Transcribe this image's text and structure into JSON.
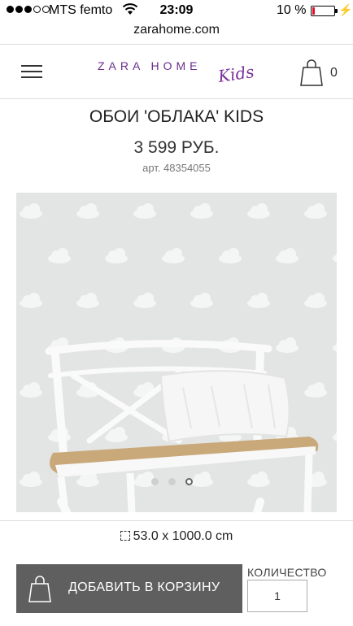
{
  "status_bar": {
    "carrier": "MTS femto",
    "time": "23:09",
    "battery_percent": "10 %",
    "battery_level": 0.1
  },
  "browser": {
    "url": "zarahome.com"
  },
  "header": {
    "brand": "ZARA HOME",
    "sub_brand": "Kids",
    "cart_count": "0"
  },
  "product": {
    "title": "ОБОИ 'ОБЛАКА' KIDS",
    "price": "3 599 РУБ.",
    "article": "арт. 48354055",
    "size": "53.0 x 1000.0 cm",
    "gallery": {
      "total": 3,
      "active_index": 2
    }
  },
  "actions": {
    "add_to_cart_label": "ДОБАВИТЬ В КОРЗИНУ",
    "quantity_label": "КОЛИЧЕСТВО",
    "quantity_value": "1"
  },
  "colors": {
    "brand_purple": "#6b2d8a",
    "button_gray": "#5f5f5f",
    "wallpaper_gray": "#e3e4e4"
  }
}
